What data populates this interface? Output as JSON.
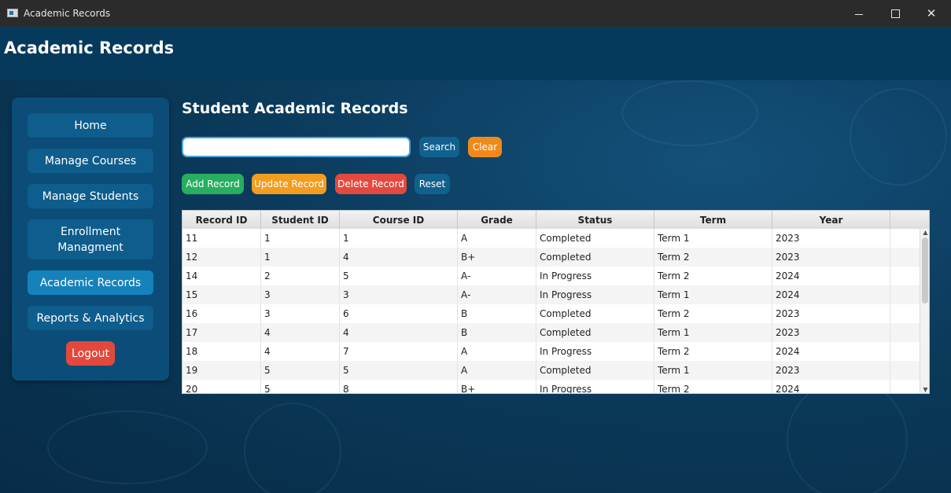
{
  "window": {
    "title": "Academic Records"
  },
  "header": {
    "title": "Academic Records"
  },
  "sidebar": {
    "items": [
      {
        "label": "Home"
      },
      {
        "label": "Manage Courses"
      },
      {
        "label": "Manage Students"
      },
      {
        "label": "Enrollment Managment"
      },
      {
        "label": "Academic Records",
        "active": true
      },
      {
        "label": "Reports & Analytics"
      }
    ],
    "logout_label": "Logout"
  },
  "main": {
    "title": "Student Academic Records",
    "search": {
      "value": "",
      "placeholder": ""
    },
    "search_button": "Search",
    "clear_button": "Clear",
    "actions": {
      "add": "Add Record",
      "update": "Update Record",
      "delete": "Delete Record",
      "reset": "Reset"
    }
  },
  "table": {
    "columns": [
      "Record ID",
      "Student ID",
      "Course ID",
      "Grade",
      "Status",
      "Term",
      "Year"
    ],
    "rows": [
      [
        "11",
        "1",
        "1",
        "A",
        "Completed",
        "Term 1",
        "2023"
      ],
      [
        "12",
        "1",
        "4",
        "B+",
        "Completed",
        "Term 2",
        "2023"
      ],
      [
        "14",
        "2",
        "5",
        "A-",
        "In Progress",
        "Term 2",
        "2024"
      ],
      [
        "15",
        "3",
        "3",
        "A-",
        "In Progress",
        "Term 1",
        "2024"
      ],
      [
        "16",
        "3",
        "6",
        "B",
        "Completed",
        "Term 2",
        "2023"
      ],
      [
        "17",
        "4",
        "4",
        "B",
        "Completed",
        "Term 1",
        "2023"
      ],
      [
        "18",
        "4",
        "7",
        "A",
        "In Progress",
        "Term 2",
        "2024"
      ],
      [
        "19",
        "5",
        "5",
        "A",
        "Completed",
        "Term 1",
        "2023"
      ],
      [
        "20",
        "5",
        "8",
        "B+",
        "In Progress",
        "Term 2",
        "2024"
      ]
    ]
  },
  "colors": {
    "header_bg": "#063a5c",
    "sidebar_bg": "#0b4d78",
    "nav_active": "#1582bb",
    "search_button": "#11618f",
    "clear_button": "#ef8a1a",
    "add_button": "#27ae60",
    "update_button": "#f29d1f",
    "delete_button": "#e4493f",
    "logout_button": "#e2493c"
  }
}
